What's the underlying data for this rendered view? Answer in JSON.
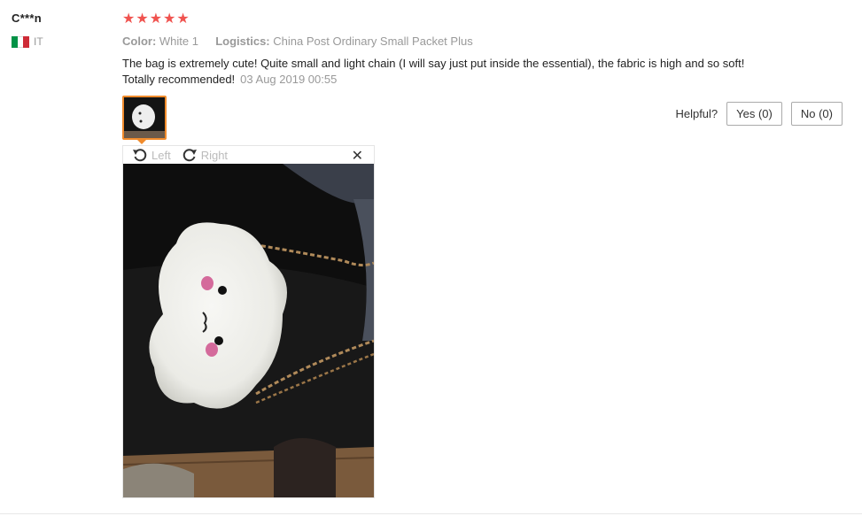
{
  "review": {
    "user_name": "C***n",
    "country_code": "IT",
    "rating": 5,
    "attributes": [
      {
        "key": "Color:",
        "value": "White 1"
      },
      {
        "key": "Logistics:",
        "value": "China Post Ordinary Small Packet Plus"
      }
    ],
    "text": "The bag is extremely cute! Quite small and light chain (I will say just put inside the essential), the fabric is high and so soft! Totally recommended!",
    "date": "03 Aug 2019 00:55"
  },
  "helpful": {
    "label": "Helpful?",
    "yes_label": "Yes (0)",
    "no_label": "No (0)"
  },
  "viewer": {
    "rotate_left_label": "Left",
    "rotate_right_label": "Right",
    "close_glyph": "✕"
  },
  "colors": {
    "star": "#f0534f",
    "thumb_border": "#f08b2c",
    "flag": [
      "#009246",
      "#ffffff",
      "#ce2b37"
    ]
  },
  "icons": [
    "rotate-left-icon",
    "rotate-right-icon",
    "close-icon",
    "star-icon",
    "flag-icon"
  ]
}
